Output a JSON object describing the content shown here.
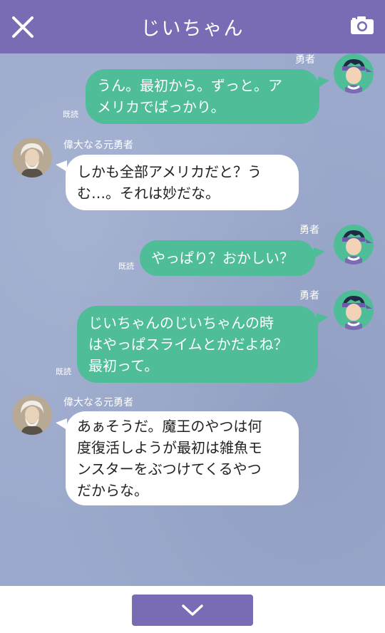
{
  "header": {
    "title": "じいちゃん",
    "close_icon": "close-icon",
    "camera_icon": "camera-icon"
  },
  "colors": {
    "header": "#7a6cb4",
    "background": "#9ba9cc",
    "outgoing_bubble": "#4ebd98",
    "incoming_bubble": "#ffffff"
  },
  "messages": [
    {
      "direction": "out",
      "sender": "勇者",
      "read": "既読",
      "lines": [
        "うん。最初から。ずっと。ア",
        "メリカでばっかり。"
      ]
    },
    {
      "direction": "in",
      "sender": "偉大なる元勇者",
      "lines": [
        "しかも全部アメリカだと？う",
        "む…。それは妙だな。"
      ]
    },
    {
      "direction": "out",
      "sender": "勇者",
      "read": "既読",
      "lines": [
        "やっぱり？おかしい？"
      ]
    },
    {
      "direction": "out",
      "sender": "勇者",
      "read": "既読",
      "lines": [
        "じいちゃんのじいちゃんの時",
        "はやっぱスライムとかだよね？",
        "最初って。"
      ]
    },
    {
      "direction": "in",
      "sender": "偉大なる元勇者",
      "lines": [
        "あぁそうだ。魔王のやつは何",
        "度復活しようが最初は雑魚モ",
        "ンスターをぶつけてくるやつ",
        "だからな。"
      ]
    }
  ],
  "footer": {
    "scroll_down_icon": "chevron-down-icon"
  }
}
